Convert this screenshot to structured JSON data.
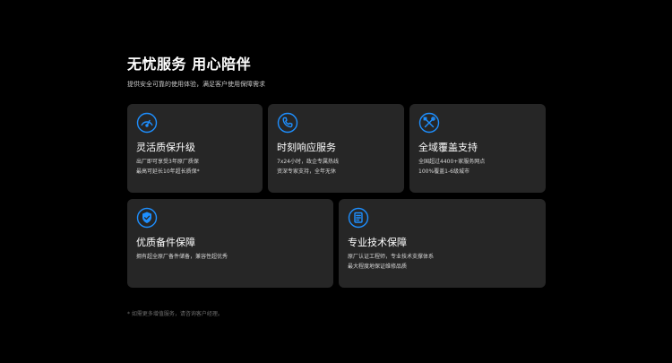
{
  "header": {
    "title": "无忧服务 用心陪伴",
    "subtitle": "提供安全可靠的使用体验，满足客户使用保障需求"
  },
  "colors": {
    "background": "#000000",
    "card": "#262626",
    "accent": "#1e8fff"
  },
  "cards": [
    {
      "icon": "speedometer-icon",
      "title": "灵活质保升级",
      "lines": [
        "出厂即可享受3年原厂质保",
        "最高可延长10年超长质保*"
      ]
    },
    {
      "icon": "phone-icon",
      "title": "时刻响应服务",
      "lines": [
        "7x24小时，政企专属热线",
        "资深专家支持，全年无休"
      ]
    },
    {
      "icon": "tools-icon",
      "title": "全域覆盖支持",
      "lines": [
        "全国超过4400+家服务网点",
        "100%覆盖1-6级城市"
      ]
    },
    {
      "icon": "shield-check-icon",
      "title": "优质备件保障",
      "lines": [
        "拥有超全原厂备件储备，兼容性超优秀"
      ]
    },
    {
      "icon": "document-icon",
      "title": "专业技术保障",
      "lines": [
        "原厂认证工程师，专业技术支撑体系",
        "最大程度地保证维修品质"
      ]
    }
  ],
  "footnote": "* 如需更多增值服务，请咨询客户经理。"
}
